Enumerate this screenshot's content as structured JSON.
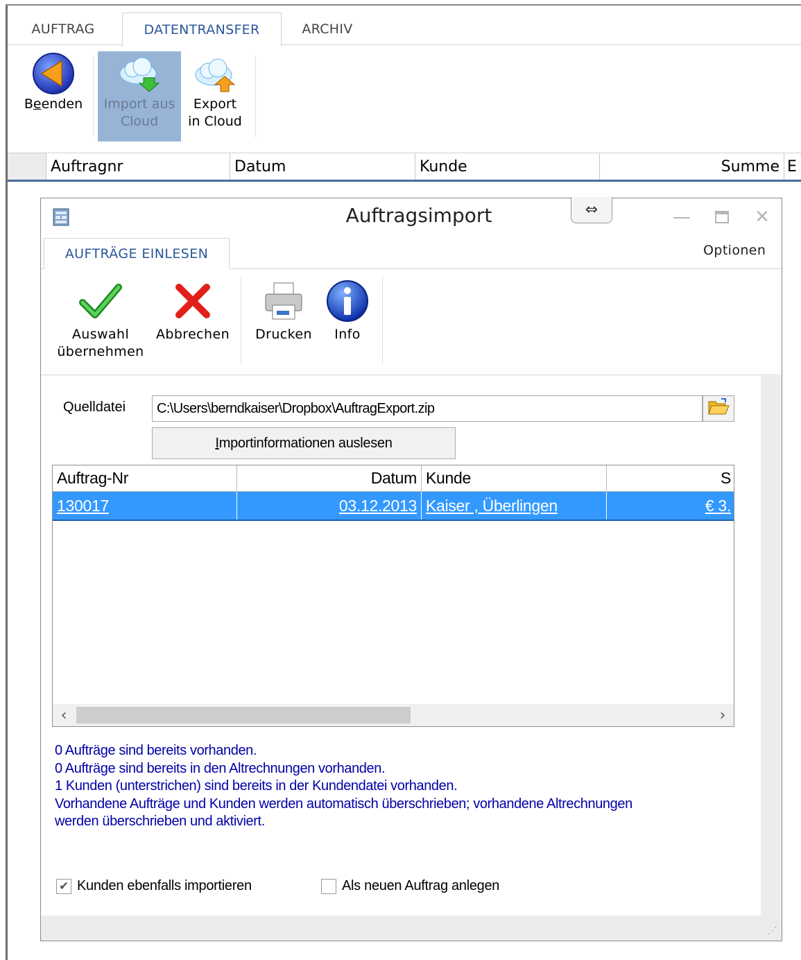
{
  "main": {
    "tabs": [
      {
        "label": "AUFTRAG"
      },
      {
        "label": "DATENTRANSFER"
      },
      {
        "label": "ARCHIV"
      }
    ],
    "ribbon": {
      "quit": {
        "label_html": "Beenden",
        "icon": "back-arrow-icon"
      },
      "import_line1": "Import aus",
      "import_line2": "Cloud",
      "export_line1": "Export",
      "export_line2": "in Cloud"
    },
    "grid_columns": [
      "Auftragnr",
      "Datum",
      "Kunde",
      "Summe",
      "E"
    ]
  },
  "dialog": {
    "title": "Auftragsimport",
    "swap_icon": "⇔",
    "tab": "AUFTRÄGE EINLESEN",
    "options": "Optionen",
    "buttons": {
      "accept_line1": "Auswahl",
      "accept_line2": "übernehmen",
      "cancel": "Abbrechen",
      "print": "Drucken",
      "info": "Info"
    },
    "source_label": "Quelldatei",
    "source_path": "C:\\Users\\berndkaiser\\Dropbox\\AuftragExport.zip",
    "read_button_prefix": "I",
    "read_button_rest": "mportinformationen auslesen",
    "table": {
      "columns": [
        "Auftrag-Nr",
        "Datum",
        "Kunde",
        "S"
      ],
      "rows": [
        {
          "nr": "130017",
          "datum": "03.12.2013",
          "kunde": "Kaiser , Überlingen",
          "summe": "€ 3."
        }
      ]
    },
    "messages": [
      "0 Aufträge sind bereits vorhanden.",
      "0 Aufträge sind bereits in den Altrechnungen vorhanden.",
      "1 Kunden (unterstrichen) sind bereits in der Kundendatei vorhanden.",
      "Vorhandene Aufträge und Kunden werden automatisch überschrieben; vorhandene Altrechnungen",
      "werden überschrieben und aktiviert."
    ],
    "checkboxes": [
      {
        "label": "Kunden ebenfalls importieren",
        "checked": true
      },
      {
        "label": "Als neuen Auftrag anlegen",
        "checked": false
      }
    ]
  }
}
